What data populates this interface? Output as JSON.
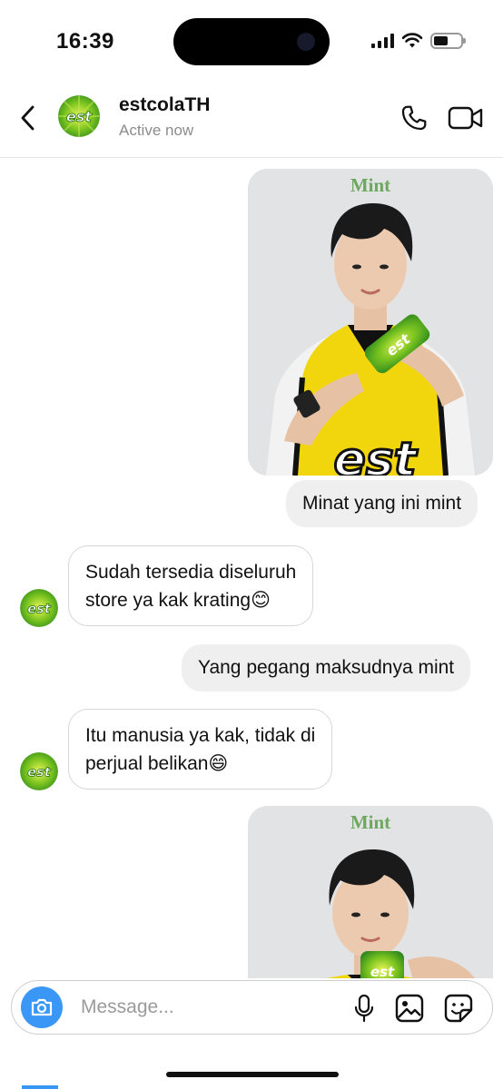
{
  "status_bar": {
    "time": "16:39",
    "icons": [
      "cellular-signal-icon",
      "wifi-icon",
      "battery-icon"
    ],
    "battery_level": 0.55
  },
  "header": {
    "contact_name": "estcolaTH",
    "contact_status": "Active now",
    "avatar_text": "est",
    "icons": [
      "back-chevron-icon",
      "phone-icon",
      "video-camera-icon"
    ]
  },
  "messages": [
    {
      "id": 1,
      "direction": "outgoing",
      "type": "image",
      "caption": "Mint"
    },
    {
      "id": 2,
      "direction": "outgoing",
      "type": "text",
      "text": "Minat yang ini mint"
    },
    {
      "id": 3,
      "direction": "incoming",
      "type": "text",
      "lines": [
        "Sudah tersedia diseluruh",
        "store ya kak krating😊"
      ]
    },
    {
      "id": 4,
      "direction": "outgoing",
      "type": "text",
      "text": "Yang pegang maksudnya mint"
    },
    {
      "id": 5,
      "direction": "incoming",
      "type": "text",
      "lines": [
        "Itu manusia ya kak, tidak di",
        "perjual belikan😄"
      ]
    },
    {
      "id": 6,
      "direction": "outgoing",
      "type": "image",
      "caption": "Mint"
    }
  ],
  "composer": {
    "placeholder": "Message...",
    "icons": [
      "camera-icon",
      "microphone-icon",
      "gallery-icon",
      "sticker-icon"
    ]
  },
  "colors": {
    "accent": "#3a97f6",
    "outgoing_bubble": "#efefef",
    "brand_green": "#6ea85e",
    "jersey_yellow": "#f2d60d"
  }
}
